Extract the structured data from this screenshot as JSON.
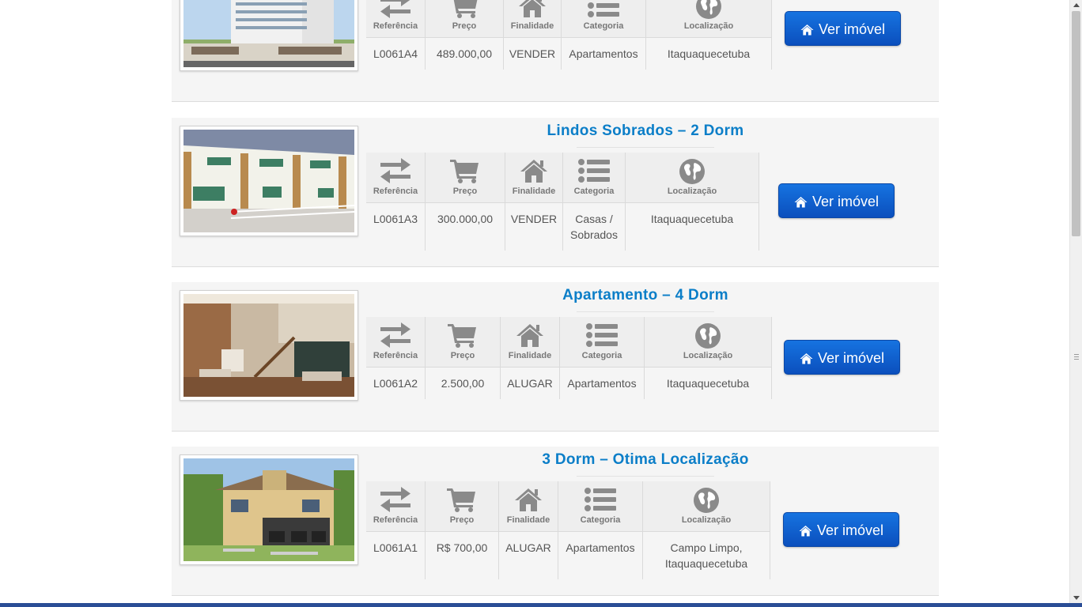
{
  "labels": {
    "referencia": "Referência",
    "preco": "Preço",
    "finalidade": "Finalidade",
    "categoria": "Categoria",
    "localizacao": "Localização"
  },
  "button_label": "Ver imóvel",
  "listings": [
    {
      "title": "",
      "ref": "L0061A4",
      "price": "489.000,00",
      "purpose": "VENDER",
      "category": "Apartamentos",
      "location": "Itaquaquecetuba"
    },
    {
      "title": "Lindos Sobrados – 2 Dorm",
      "ref": "L0061A3",
      "price": "300.000,00",
      "purpose": "VENDER",
      "category": "Casas / Sobrados",
      "location": "Itaquaquecetuba"
    },
    {
      "title": "Apartamento – 4 Dorm",
      "ref": "L0061A2",
      "price": "2.500,00",
      "purpose": "ALUGAR",
      "category": "Apartamentos",
      "location": "Itaquaquecetuba"
    },
    {
      "title": "3 Dorm – Otima Localização",
      "ref": "L0061A1",
      "price": "R$ 700,00",
      "purpose": "ALUGAR",
      "category": "Apartamentos",
      "location": "Campo Limpo, Itaquaquecetuba"
    }
  ],
  "icons": {
    "reference": "exchange-icon",
    "price": "shopping-cart-icon",
    "purpose": "home-icon",
    "category": "list-icon",
    "location": "globe-icon",
    "button": "home-icon"
  },
  "colors": {
    "title": "#0b7ec8",
    "button": "#0b5fcf",
    "card_background": "#f5f5f5",
    "bottom_bar": "#2a4d96"
  }
}
